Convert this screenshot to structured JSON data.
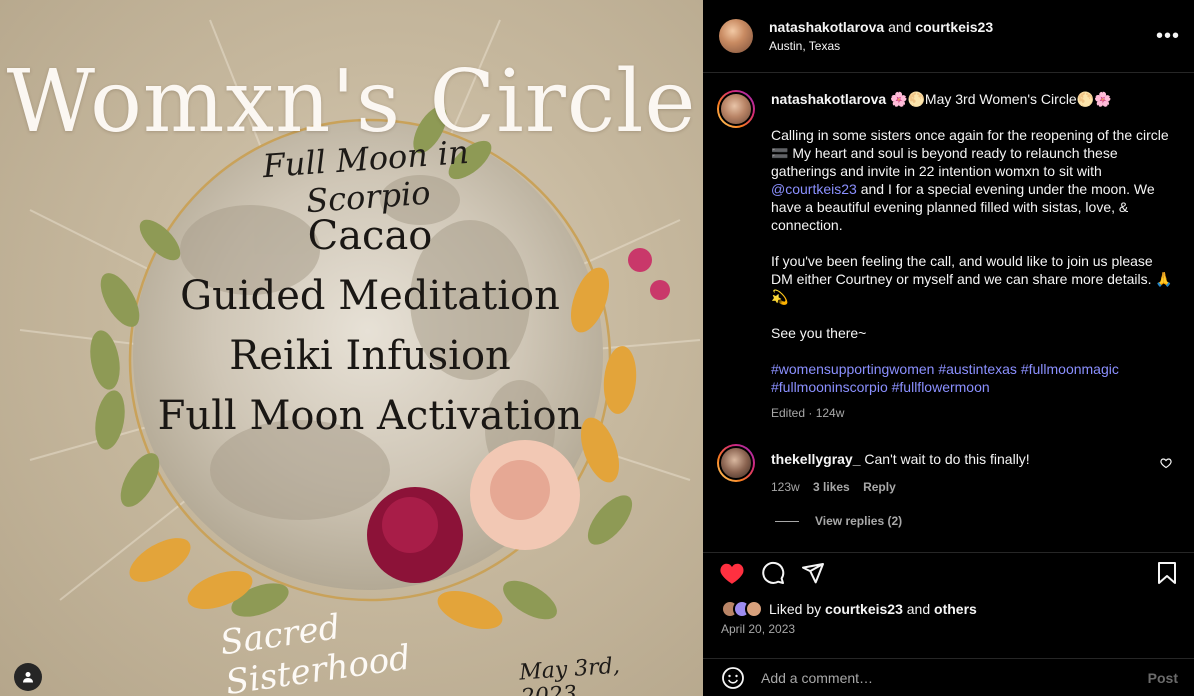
{
  "image": {
    "title": "Womxn's Circle",
    "subtitle": "Full Moon in Scorpio",
    "activities": [
      "Cacao",
      "Guided Meditation",
      "Reiki Infusion",
      "Full Moon Activation"
    ],
    "footer_script": "Sacred Sisterhood",
    "event_date": "May 3rd, 2023"
  },
  "header": {
    "author": "natashakotlarova",
    "joiner": "and",
    "collaborator": "courtkeis23",
    "location": "Austin, Texas",
    "more_label": "•••"
  },
  "caption": {
    "username": "natashakotlarova",
    "headline": "🌸🌕May 3rd Women's Circle🌕🌸",
    "para1_start": "Calling in some sisters once again for the reopening of the circle 🟰 My heart and soul is beyond ready to relaunch these gatherings and invite in 22 intention womxn to sit with ",
    "mention": "@courtkeis23",
    "para1_end": " and I for a special evening under the moon. We have a beautiful evening planned filled with sistas, love, & connection.",
    "para2": "If you've been feeling the call, and would like to join us please DM either Courtney or myself and we can share more details. 🙏💫",
    "para3": "See you there~",
    "hashtags": "#womensupportingwomen #austintexas #fullmoonmagic #fullmooninscorpio #fullflowermoon",
    "edited": "Edited · 124w"
  },
  "comment": {
    "username": "thekellygray_",
    "text": "Can't wait to do this finally!",
    "age": "123w",
    "likes": "3 likes",
    "reply_label": "Reply",
    "view_replies": "View replies (2)"
  },
  "likes": {
    "prefix": "Liked by",
    "user": "courtkeis23",
    "joiner": "and",
    "others": "others"
  },
  "post_date": "April 20, 2023",
  "composer": {
    "placeholder": "Add a comment…",
    "post_label": "Post"
  },
  "colors": {
    "like_red": "#ff3040",
    "link_blue": "#8b90ff",
    "muted": "#a8a8a8"
  }
}
